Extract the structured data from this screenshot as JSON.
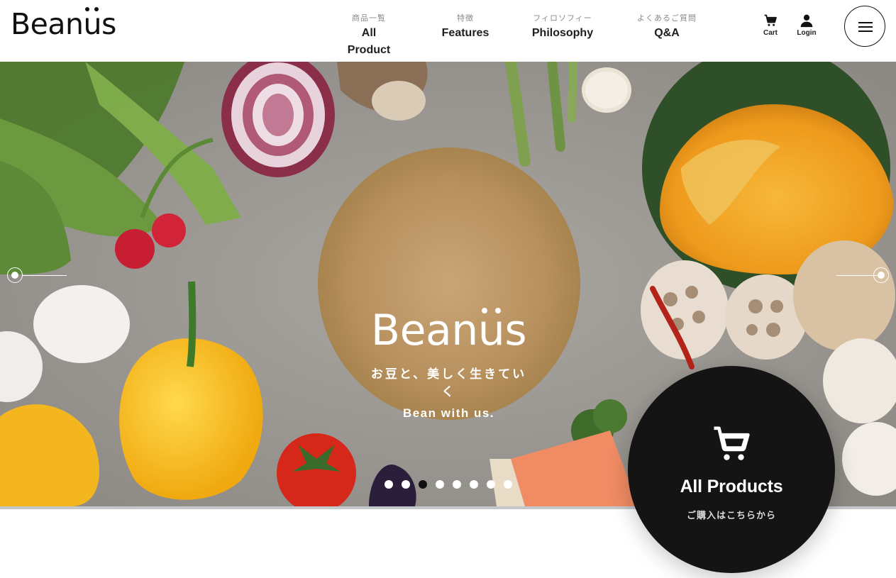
{
  "brand": {
    "logo_text_pre": "Bean",
    "logo_text_u": "u",
    "logo_text_post": "s"
  },
  "nav": [
    {
      "jp": "商品一覧",
      "en": "All Product"
    },
    {
      "jp": "特徴",
      "en": "Features"
    },
    {
      "jp": "フィロソフィー",
      "en": "Philosophy"
    },
    {
      "jp": "よくあるご質問",
      "en": "Q&A"
    }
  ],
  "header_actions": {
    "cart_label": "Cart",
    "login_label": "Login"
  },
  "hero": {
    "logo_pre": "Bean",
    "logo_u": "u",
    "logo_post": "s",
    "tagline_jp": "お豆と、美しく生きていく",
    "tagline_en": "Bean with us.",
    "slide_count": 8,
    "active_slide": 3
  },
  "cta": {
    "title": "All Products",
    "subtitle": "ご購入はこちらから"
  },
  "colors": {
    "cta_bg": "#141414",
    "active_dot": "#111111",
    "dot": "#ffffff",
    "hero_bg": "#9c9893"
  },
  "icons": {
    "cart": "cart-icon",
    "login": "user-icon",
    "menu": "hamburger-icon",
    "prev": "prev-arrow-icon",
    "next": "next-arrow-icon"
  }
}
